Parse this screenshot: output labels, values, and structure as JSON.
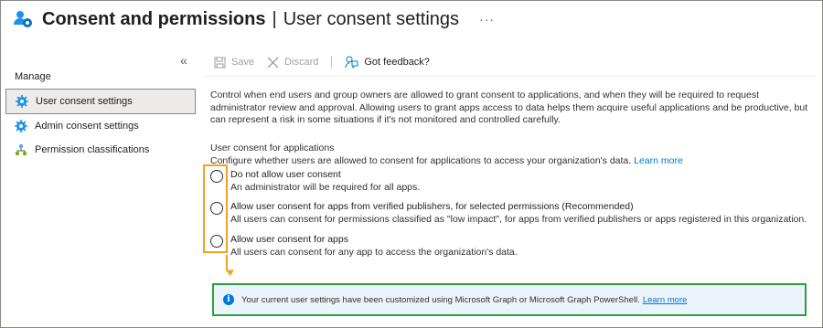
{
  "header": {
    "title_main": "Consent and permissions",
    "title_separator": "|",
    "title_sub": "User consent settings",
    "more_label": "···"
  },
  "sidebar": {
    "collapse_label": "«",
    "section_title": "Manage",
    "items": [
      {
        "label": "User consent settings",
        "icon": "gear-icon",
        "active": true
      },
      {
        "label": "Admin consent settings",
        "icon": "gear-icon",
        "active": false
      },
      {
        "label": "Permission classifications",
        "icon": "hierarchy-icon",
        "active": false
      }
    ]
  },
  "toolbar": {
    "save_label": "Save",
    "discard_label": "Discard",
    "feedback_label": "Got feedback?"
  },
  "content": {
    "description": "Control when end users and group owners are allowed to grant consent to applications, and when they will be required to request administrator review and approval. Allowing users to grant apps access to data helps them acquire useful applications and be productive, but can represent a risk in some situations if it's not monitored and controlled carefully.",
    "section_title": "User consent for applications",
    "section_desc": "Configure whether users are allowed to consent for applications to access your organization's data.",
    "learn_more": "Learn more",
    "options": [
      {
        "label": "Do not allow user consent",
        "sub": "An administrator will be required for all apps.",
        "selected": false
      },
      {
        "label": "Allow user consent for apps from verified publishers, for selected permissions (Recommended)",
        "sub": "All users can consent for permissions classified as \"low impact\", for apps from verified publishers or apps registered in this organization.",
        "selected": false
      },
      {
        "label": "Allow user consent for apps",
        "sub": "All users can consent for any app to access the organization's data.",
        "selected": false
      }
    ]
  },
  "info_bar": {
    "text": "Your current user settings have been customized using Microsoft Graph or Microsoft Graph PowerShell.",
    "link": "Learn more"
  },
  "colors": {
    "accent": "#0078d4",
    "highlight_orange": "#f7a01d",
    "highlight_green": "#2aa13c",
    "info_background": "#ebf3fc"
  }
}
